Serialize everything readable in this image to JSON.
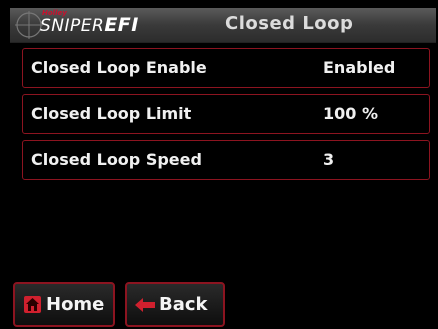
{
  "header": {
    "brand_small": "Holley",
    "brand_sniper": "SNIPER",
    "brand_efi": "EFI",
    "title": "Closed Loop"
  },
  "rows": [
    {
      "label": "Closed Loop Enable",
      "value": "Enabled"
    },
    {
      "label": "Closed Loop Limit",
      "value": "100 %"
    },
    {
      "label": "Closed Loop Speed",
      "value": "3"
    }
  ],
  "buttons": {
    "home_label": "Home",
    "back_label": "Back"
  },
  "colors": {
    "accent": "#8c1420",
    "icon_red": "#d0202e",
    "background": "#000000"
  },
  "icons": {
    "home": "home-icon",
    "back": "arrow-left-icon",
    "logo": "crosshair-icon"
  }
}
